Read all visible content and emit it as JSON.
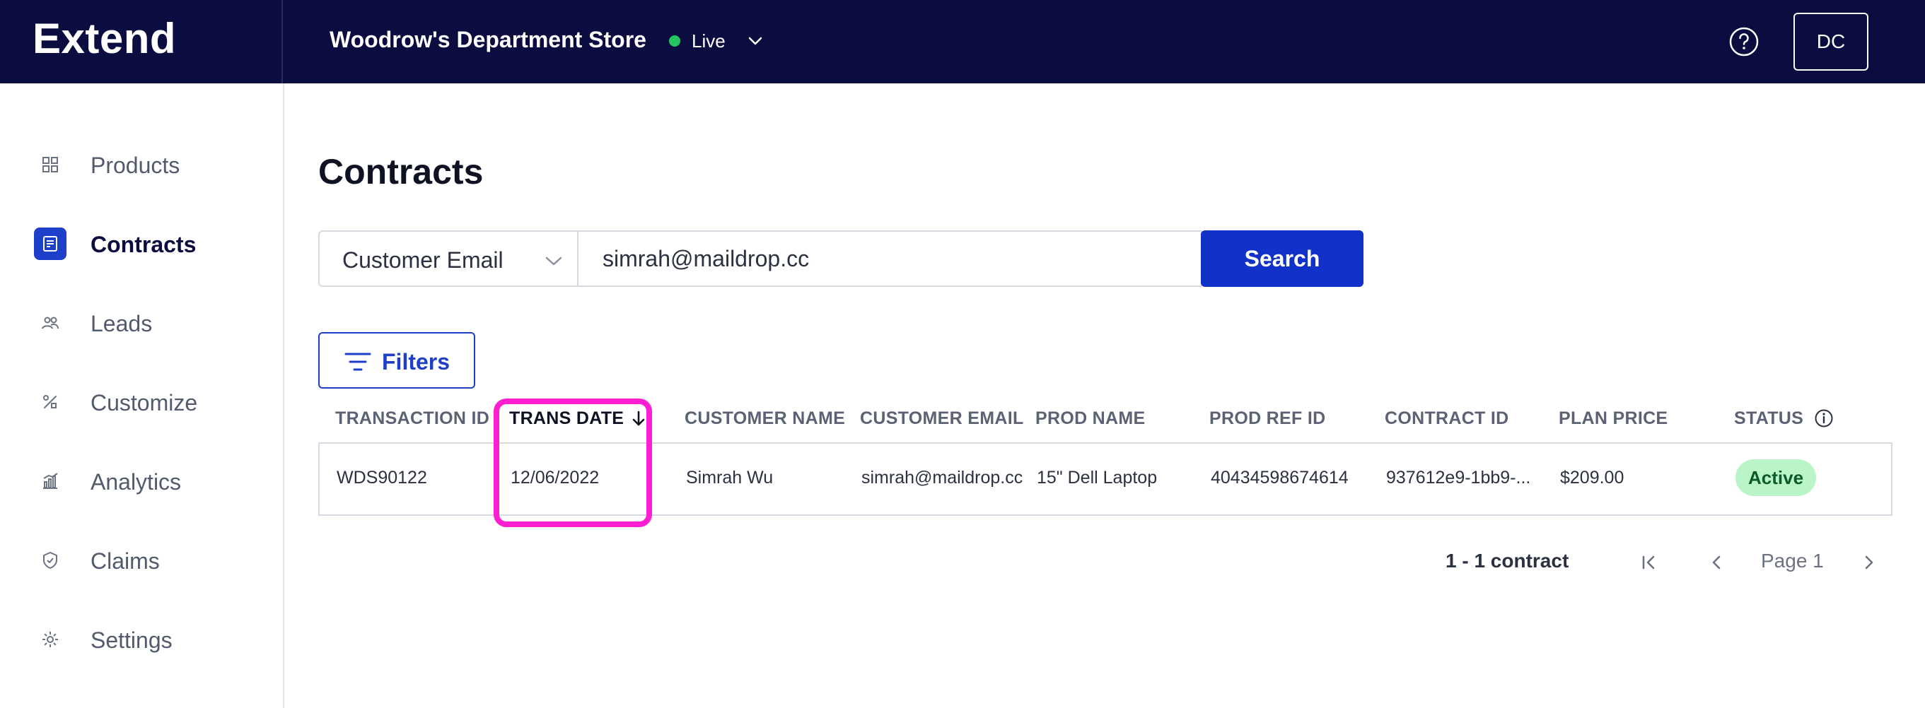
{
  "app": {
    "brand": "Extend",
    "store_name": "Woodrow's Department Store",
    "env_label": "Live",
    "user_initials": "DC"
  },
  "sidebar": {
    "items": [
      {
        "label": "Products",
        "icon": "grid-icon",
        "active": false
      },
      {
        "label": "Contracts",
        "icon": "contract-icon",
        "active": true
      },
      {
        "label": "Leads",
        "icon": "users-icon",
        "active": false
      },
      {
        "label": "Customize",
        "icon": "tools-icon",
        "active": false
      },
      {
        "label": "Analytics",
        "icon": "chart-icon",
        "active": false
      },
      {
        "label": "Claims",
        "icon": "shield-icon",
        "active": false
      },
      {
        "label": "Settings",
        "icon": "gear-icon",
        "active": false
      }
    ]
  },
  "main": {
    "title": "Contracts",
    "search": {
      "field_selected": "Customer Email",
      "value": "simrah@maildrop.cc",
      "button_label": "Search"
    },
    "filters_label": "Filters",
    "table": {
      "columns": [
        "TRANSACTION ID",
        "TRANS DATE",
        "CUSTOMER NAME",
        "CUSTOMER EMAIL",
        "PROD NAME",
        "PROD REF ID",
        "CONTRACT ID",
        "PLAN PRICE",
        "STATUS"
      ],
      "sorted_column": "TRANS DATE",
      "sort_direction": "descending",
      "rows": [
        {
          "transaction_id": "WDS90122",
          "trans_date": "12/06/2022",
          "customer_name": "Simrah Wu",
          "customer_email": "simrah@maildrop.cc",
          "prod_name": "15\" Dell Laptop",
          "prod_ref_id": "40434598674614",
          "contract_id": "937612e9-1bb9-...",
          "plan_price": "$209.00",
          "status": "Active"
        }
      ]
    },
    "pagination": {
      "summary": "1 - 1 contract",
      "page_label": "Page 1"
    }
  },
  "colors": {
    "topbar": "#0b0c3f",
    "primary": "#1231c9",
    "live": "#22c55e",
    "active_badge": "#b9f5c8",
    "highlight": "#ff1fd2"
  }
}
